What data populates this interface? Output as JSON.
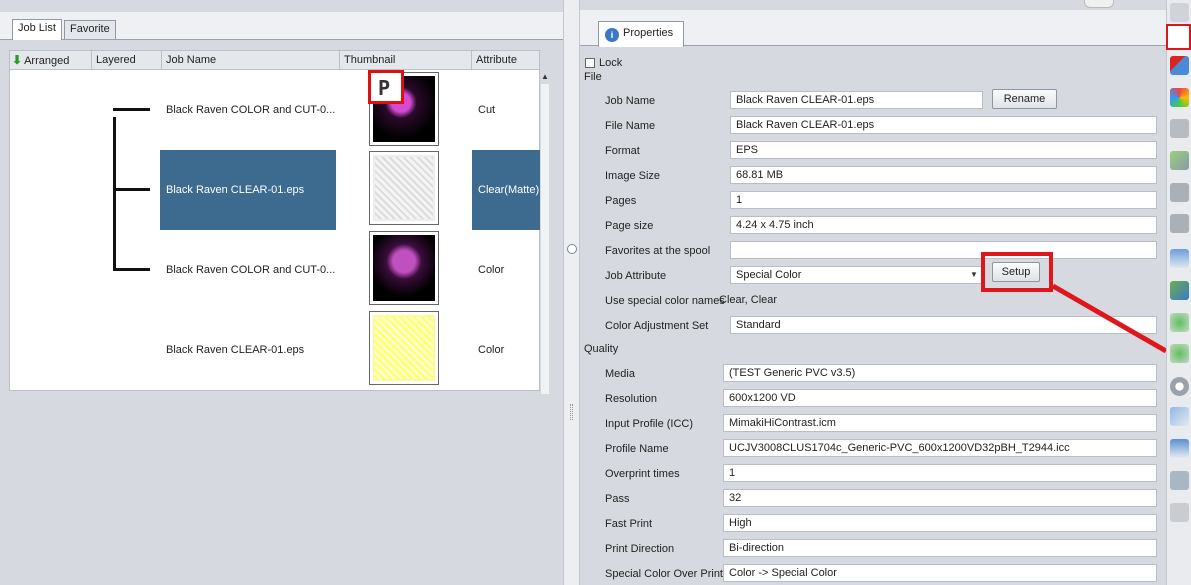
{
  "left_tabs": [
    "Job List",
    "Favorite"
  ],
  "grid_headers": {
    "arranged": "Arranged",
    "layered": "Layered",
    "job_name": "Job Name",
    "thumbnail": "Thumbnail",
    "attribute": "Attribute"
  },
  "jobs": [
    {
      "name": "Black Raven COLOR and CUT-0...",
      "attribute": "Cut"
    },
    {
      "name": "Black Raven CLEAR-01.eps",
      "attribute": "Clear(Matte)"
    },
    {
      "name": "Black Raven COLOR and CUT-0...",
      "attribute": "Color"
    },
    {
      "name": "Black Raven CLEAR-01.eps",
      "attribute": "Color"
    }
  ],
  "properties": {
    "tab_label": "Properties",
    "lock_label": "Lock",
    "file_section": "File",
    "quality_section": "Quality",
    "rename_button": "Rename",
    "setup_button": "Setup",
    "fields": {
      "job_name": {
        "label": "Job Name",
        "value": "Black Raven CLEAR-01.eps"
      },
      "file_name": {
        "label": "File Name",
        "value": "Black Raven CLEAR-01.eps"
      },
      "format": {
        "label": "Format",
        "value": "EPS"
      },
      "image_size": {
        "label": "Image Size",
        "value": "68.81 MB"
      },
      "pages": {
        "label": "Pages",
        "value": "1"
      },
      "page_size": {
        "label": "Page size",
        "value": "4.24 x 4.75 inch"
      },
      "favorites": {
        "label": "Favorites at the spool",
        "value": ""
      },
      "job_attribute": {
        "label": "Job Attribute",
        "value": "Special Color"
      },
      "special_color_names": {
        "label": "Use special color names",
        "value": "Clear, Clear"
      },
      "color_adjustment": {
        "label": "Color Adjustment Set",
        "value": "Standard"
      },
      "media": {
        "label": "Media",
        "value": "(TEST Generic PVC v3.5)"
      },
      "resolution": {
        "label": "Resolution",
        "value": "600x1200 VD"
      },
      "input_profile": {
        "label": "Input Profile (ICC)",
        "value": "MimakiHiContrast.icm"
      },
      "profile_name": {
        "label": "Profile Name",
        "value": "UCJV3008CLUS1704c_Generic-PVC_600x1200VD32pBH_T2944.icc"
      },
      "overprint": {
        "label": "Overprint times",
        "value": "1"
      },
      "pass": {
        "label": "Pass",
        "value": "32"
      },
      "fast_print": {
        "label": "Fast Print",
        "value": "High"
      },
      "print_direction": {
        "label": "Print Direction",
        "value": "Bi-direction"
      },
      "special_color_over_print": {
        "label": "Special Color Over Print",
        "value": "Color -> Special Color"
      }
    }
  },
  "toolbar_icons": [
    "info-icon",
    "layout-icon",
    "color-icon",
    "blank-icon",
    "raster-icon",
    "print-icon",
    "cut-icon",
    "queue-icon",
    "move-icon",
    "favorite-icon",
    "add-icon",
    "target-icon",
    "copy-icon",
    "split-icon",
    "trash-icon",
    "help-icon"
  ],
  "colors": {
    "selection": "#3d6a8f",
    "highlight_red": "#e0161d"
  }
}
